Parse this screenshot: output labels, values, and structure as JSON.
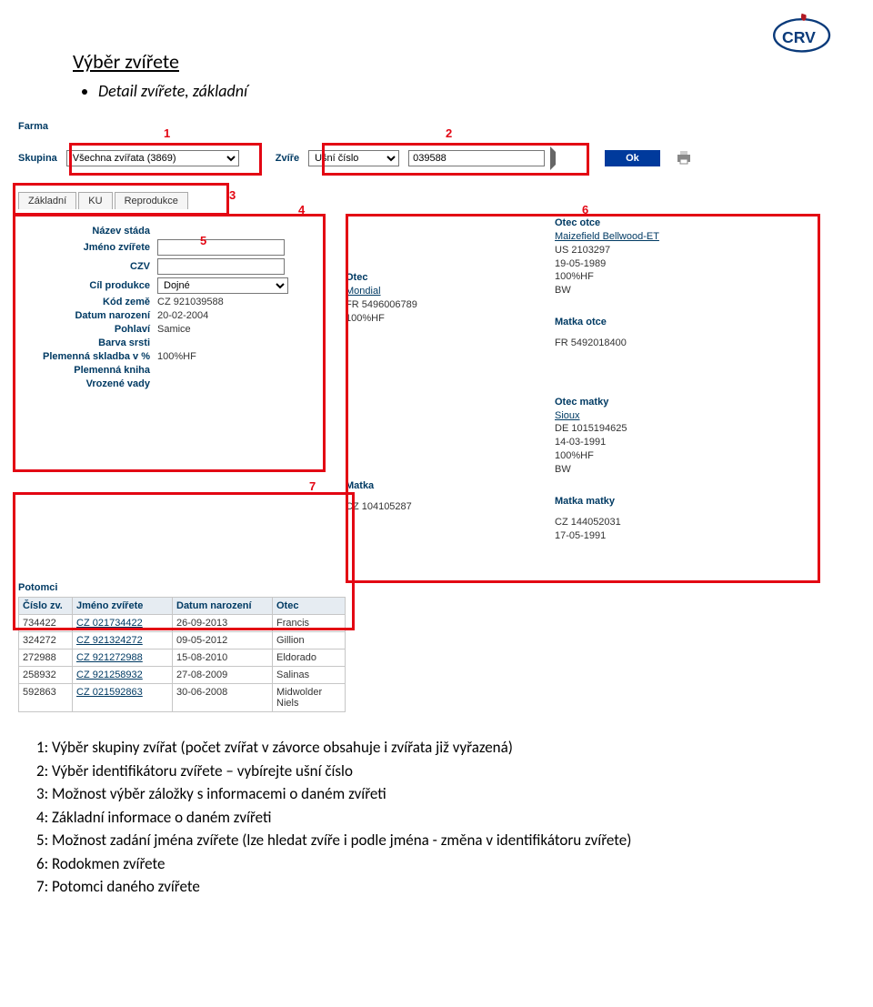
{
  "title": "Výběr zvířete",
  "bullet": "Detail zvířete, základní",
  "filters": {
    "farma_label": "Farma",
    "skupina_label": "Skupina",
    "skupina_value": "Všechna zvířata (3869)",
    "zvire_label": "Zvíře",
    "zvire_type": "Ušní číslo",
    "zvire_value": "039588",
    "ok_label": "Ok"
  },
  "markers": {
    "1": "1",
    "2": "2",
    "3": "3",
    "4": "4",
    "5": "5",
    "6": "6",
    "7": "7"
  },
  "tabs": {
    "zakladni": "Základní",
    "ku": "KU",
    "reprodukce": "Reprodukce"
  },
  "basic": {
    "nazev_label": "Název stáda",
    "jmeno_label": "Jméno zvířete",
    "jmeno_value": "",
    "czv_label": "CZV",
    "czv_value": "",
    "cil_label": "Cíl produkce",
    "cil_value": "Dojné",
    "kod_label": "Kód země",
    "kod_value": "CZ 921039588",
    "datum_label": "Datum narození",
    "datum_value": "20-02-2004",
    "pohlavi_label": "Pohlaví",
    "pohlavi_value": "Samice",
    "barva_label": "Barva srsti",
    "skladba_label": "Plemenná skladba v %",
    "skladba_value": "100%HF",
    "kniha_label": "Plemenná kniha",
    "vady_label": "Vrozené vady"
  },
  "pedigree": {
    "otec_label": "Otec",
    "otec_name": "Mondial",
    "otec_lines": [
      "FR 5496006789",
      "100%HF"
    ],
    "matka_label": "Matka",
    "matka_lines": [
      "CZ 104105287"
    ],
    "otec_otce_label": "Otec otce",
    "otec_otce_name": "Maizefield Bellwood-ET",
    "otec_otce_lines": [
      "US 2103297",
      "19-05-1989",
      "100%HF",
      "BW"
    ],
    "matka_otce_label": "Matka otce",
    "matka_otce_lines": [
      "FR 5492018400"
    ],
    "otec_matky_label": "Otec matky",
    "otec_matky_name": "Sioux",
    "otec_matky_lines": [
      "DE 1015194625",
      "14-03-1991",
      "100%HF",
      "BW"
    ],
    "matka_matky_label": "Matka matky",
    "matka_matky_lines": [
      "CZ 144052031",
      "17-05-1991"
    ]
  },
  "potomci": {
    "title": "Potomci",
    "headers": [
      "Číslo zv.",
      "Jméno zvířete",
      "Datum narození",
      "Otec"
    ],
    "rows": [
      [
        "734422",
        "CZ 021734422",
        "26-09-2013",
        "Francis"
      ],
      [
        "324272",
        "CZ 921324272",
        "09-05-2012",
        "Gillion"
      ],
      [
        "272988",
        "CZ 921272988",
        "15-08-2010",
        "Eldorado"
      ],
      [
        "258932",
        "CZ 921258932",
        "27-08-2009",
        "Salinas"
      ],
      [
        "592863",
        "CZ 021592863",
        "30-06-2008",
        "Midwolder Niels"
      ]
    ]
  },
  "legend": [
    "1: Výběr skupiny zvířat (počet zvířat v závorce obsahuje i zvířata již vyřazená)",
    "2: Výběr identifikátoru zvířete – vybírejte ušní číslo",
    "3: Možnost výběr záložky s informacemi o daném zvířeti",
    "4: Základní informace o daném zvířeti",
    "5: Možnost zadání jména zvířete (lze hledat zvíře i podle jména  - změna v identifikátoru zvířete)",
    "6: Rodokmen zvířete",
    "7: Potomci daného zvířete"
  ]
}
